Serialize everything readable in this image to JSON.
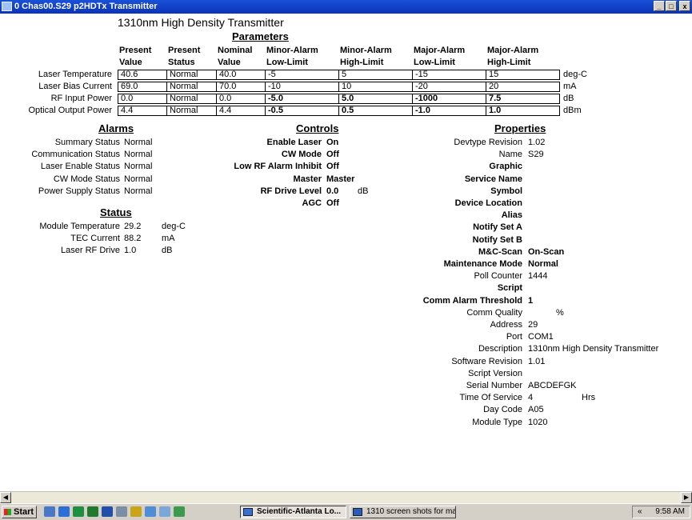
{
  "window": {
    "title": "0 Chas00.S29 p2HDTx Transmitter",
    "min": "_",
    "max": "□",
    "close": "x"
  },
  "page_title": "1310nm High Density Transmitter",
  "parameters": {
    "title": "Parameters",
    "headers": [
      {
        "l1": "Present",
        "l2": "Value"
      },
      {
        "l1": "Present",
        "l2": "Status"
      },
      {
        "l1": "Nominal",
        "l2": "Value"
      },
      {
        "l1": "Minor-Alarm",
        "l2": "Low-Limit"
      },
      {
        "l1": "Minor-Alarm",
        "l2": "High-Limit"
      },
      {
        "l1": "Major-Alarm",
        "l2": "Low-Limit"
      },
      {
        "l1": "Major-Alarm",
        "l2": "High-Limit"
      }
    ],
    "rows": [
      {
        "label": "Laser Temperature",
        "cells": [
          "40.6",
          "Normal",
          "40.0",
          "-5",
          "5",
          "-15",
          "15"
        ],
        "unit": "deg-C"
      },
      {
        "label": "Laser Bias Current",
        "cells": [
          "69.0",
          "Normal",
          "70.0",
          "-10",
          "10",
          "-20",
          "20"
        ],
        "unit": "mA"
      },
      {
        "label": "RF Input Power",
        "cells": [
          "0.0",
          "Normal",
          "0.0",
          "-5.0",
          "5.0",
          "-1000",
          "7.5"
        ],
        "unit": "dB"
      },
      {
        "label": "Optical Output Power",
        "cells": [
          "4.4",
          "Normal",
          "4.4",
          "-0.5",
          "0.5",
          "-1.0",
          "1.0"
        ],
        "unit": "dBm"
      }
    ]
  },
  "alarms": {
    "title": "Alarms",
    "items": [
      {
        "label": "Summary Status",
        "value": "Normal"
      },
      {
        "label": "Communication Status",
        "value": "Normal"
      },
      {
        "label": "Laser Enable Status",
        "value": "Normal"
      },
      {
        "label": "CW Mode Status",
        "value": "Normal"
      },
      {
        "label": "Power Supply Status",
        "value": "Normal"
      }
    ]
  },
  "status": {
    "title": "Status",
    "items": [
      {
        "label": "Module Temperature",
        "value": "29.2",
        "unit": "deg-C"
      },
      {
        "label": "TEC Current",
        "value": "88.2",
        "unit": "mA"
      },
      {
        "label": "Laser RF Drive",
        "value": "1.0",
        "unit": "dB"
      }
    ]
  },
  "controls": {
    "title": "Controls",
    "items": [
      {
        "label": "Enable Laser",
        "value": "On",
        "unit": ""
      },
      {
        "label": "CW Mode",
        "value": "Off",
        "unit": ""
      },
      {
        "label": "Low RF Alarm Inhibit",
        "value": "Off",
        "unit": ""
      },
      {
        "label": "Master",
        "value": "Master",
        "unit": ""
      },
      {
        "label": "RF Drive Level",
        "value": "0.0",
        "unit": "dB"
      },
      {
        "label": "AGC",
        "value": "Off",
        "unit": ""
      }
    ]
  },
  "properties": {
    "title": "Properties",
    "items": [
      {
        "label": "Devtype Revision",
        "value": "1.02",
        "unit": ""
      },
      {
        "label": "Name",
        "value": "S29",
        "unit": ""
      },
      {
        "label": "Graphic",
        "value": "",
        "unit": ""
      },
      {
        "label": "Service Name",
        "value": "",
        "unit": ""
      },
      {
        "label": "Symbol",
        "value": "",
        "unit": ""
      },
      {
        "label": "Device Location",
        "value": "",
        "unit": ""
      },
      {
        "label": "Alias",
        "value": "",
        "unit": ""
      },
      {
        "label": "Notify Set A",
        "value": "",
        "unit": ""
      },
      {
        "label": "Notify Set B",
        "value": "",
        "unit": ""
      },
      {
        "label": "M&C-Scan",
        "value": "On-Scan",
        "unit": ""
      },
      {
        "label": "Maintenance Mode",
        "value": "Normal",
        "unit": ""
      },
      {
        "label": "Poll Counter",
        "value": "1444",
        "unit": ""
      },
      {
        "label": "Script",
        "value": "",
        "unit": ""
      },
      {
        "label": "Comm Alarm Threshold",
        "value": "1",
        "unit": ""
      },
      {
        "label": "Comm Quality",
        "value": "",
        "unit": "%"
      },
      {
        "label": "Address",
        "value": "29",
        "unit": ""
      },
      {
        "label": "Port",
        "value": "COM1",
        "unit": ""
      },
      {
        "label": "Description",
        "value": "1310nm High Density Transmitter",
        "unit": ""
      },
      {
        "label": "Software Revision",
        "value": "1.01",
        "unit": ""
      },
      {
        "label": "Script Version",
        "value": "",
        "unit": ""
      },
      {
        "label": "Serial Number",
        "value": "ABCDEFGK",
        "unit": ""
      },
      {
        "label": "Time Of Service",
        "value": "4",
        "unit": "Hrs"
      },
      {
        "label": "Day Code",
        "value": "A05",
        "unit": ""
      },
      {
        "label": "Module Type",
        "value": "1020",
        "unit": ""
      }
    ]
  },
  "taskbar": {
    "start": "Start",
    "tasks": [
      "Scientific-Atlanta Lo...",
      "1310 screen shots for ma..."
    ],
    "tray_chevron": "«",
    "clock": "9:58 AM"
  },
  "scrollbar": {
    "left_arrow": "◀",
    "right_arrow": "▶"
  }
}
